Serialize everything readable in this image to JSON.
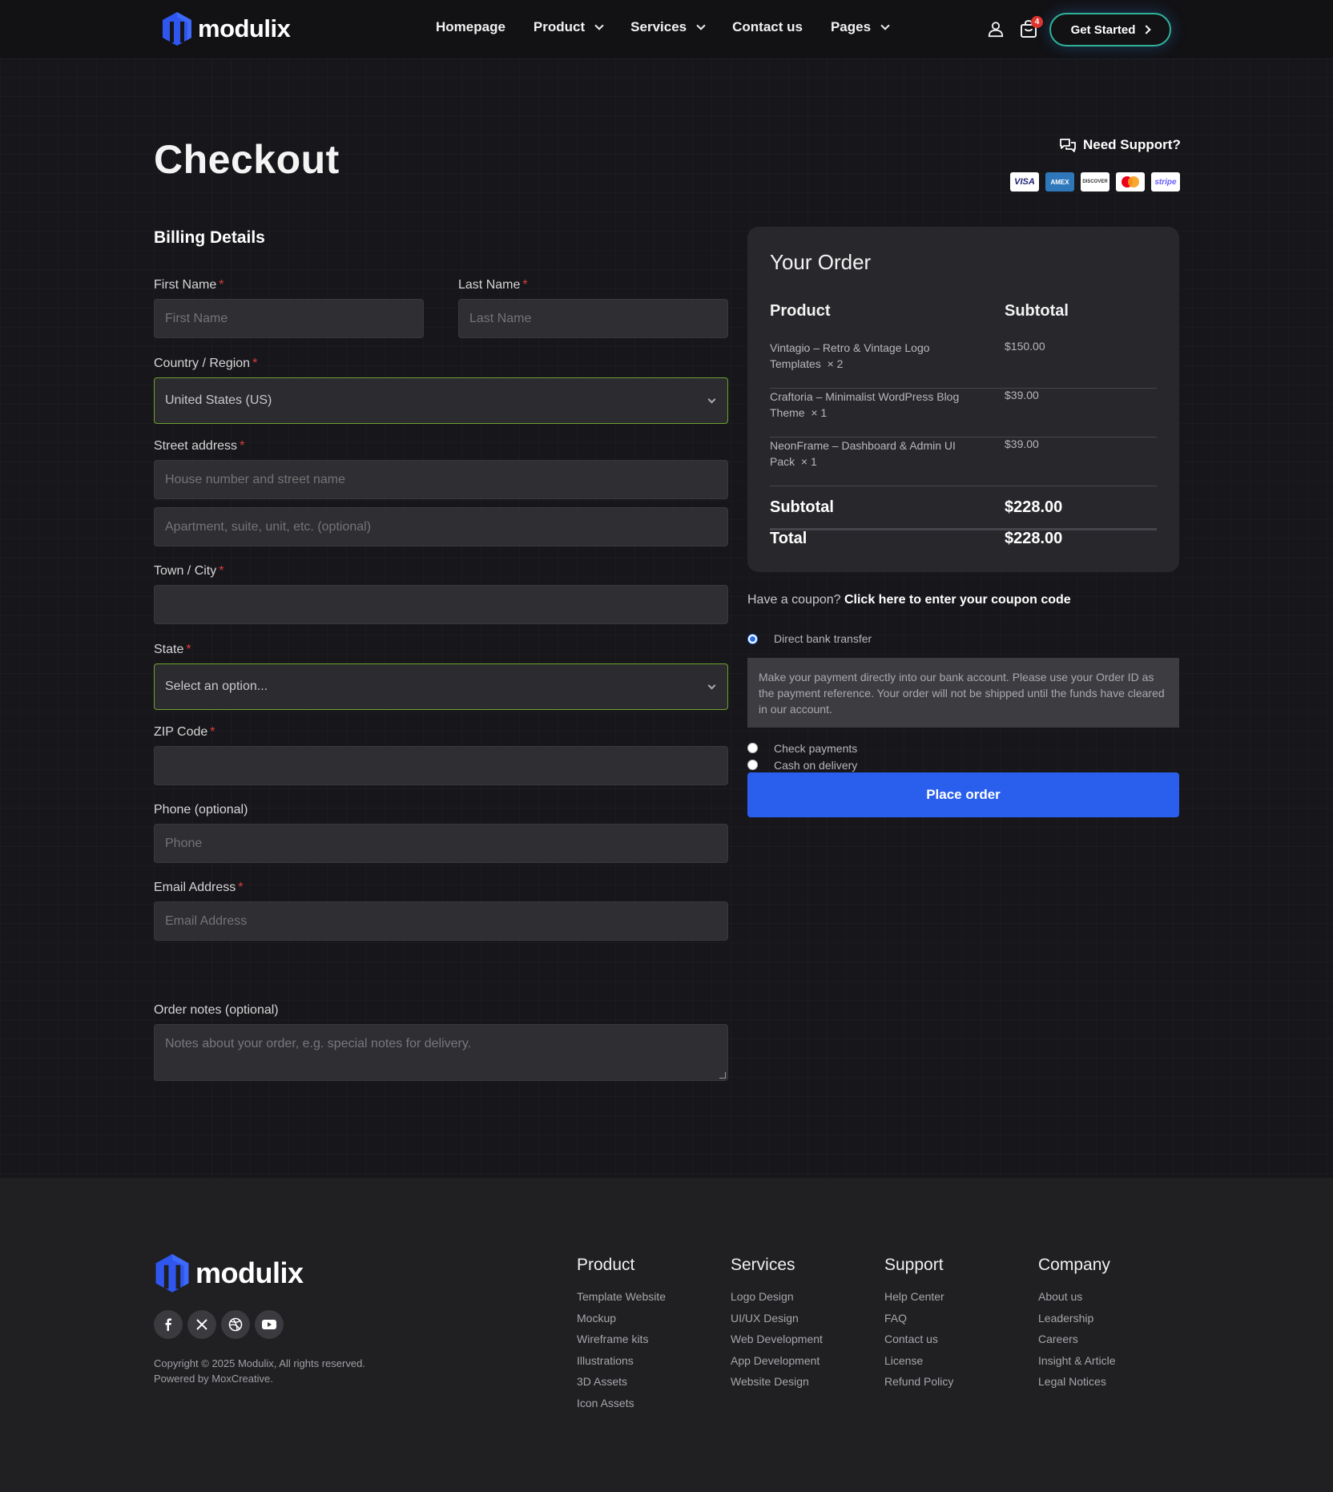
{
  "header": {
    "logo_text": "modulix",
    "nav": [
      {
        "label": "Homepage",
        "has_dropdown": false
      },
      {
        "label": "Product",
        "has_dropdown": true
      },
      {
        "label": "Services",
        "has_dropdown": true
      },
      {
        "label": "Contact us",
        "has_dropdown": false
      },
      {
        "label": "Pages",
        "has_dropdown": true
      }
    ],
    "cart_count": "4",
    "cta_label": "Get Started"
  },
  "page": {
    "title": "Checkout",
    "support_label": "Need Support?",
    "payment_cards": [
      "VISA",
      "AMEX",
      "DISCOVER",
      "Mastercard",
      "stripe"
    ]
  },
  "billing": {
    "title": "Billing Details",
    "first_name": {
      "label": "First Name",
      "placeholder": "First Name",
      "value": ""
    },
    "last_name": {
      "label": "Last Name",
      "placeholder": "Last Name",
      "value": ""
    },
    "country": {
      "label": "Country / Region",
      "value": "United States (US)"
    },
    "street": {
      "label": "Street address",
      "placeholder": "House number and street name",
      "placeholder2": "Apartment, suite, unit, etc. (optional)"
    },
    "city": {
      "label": "Town / City",
      "value": ""
    },
    "state": {
      "label": "State",
      "value": "Select an option..."
    },
    "zip": {
      "label": "ZIP Code",
      "value": ""
    },
    "phone": {
      "label": "Phone (optional)",
      "placeholder": "Phone"
    },
    "email": {
      "label": "Email Address",
      "placeholder": "Email Address"
    },
    "notes": {
      "label": "Order notes (optional)",
      "placeholder": "Notes about your order, e.g. special notes for delivery."
    }
  },
  "order": {
    "title": "Your Order",
    "col_product": "Product",
    "col_subtotal": "Subtotal",
    "items": [
      {
        "name": "Vintagio – Retro & Vintage Logo Templates",
        "qty": "× 2",
        "price": "$150.00"
      },
      {
        "name": "Craftoria – Minimalist WordPress Blog Theme",
        "qty": "× 1",
        "price": "$39.00"
      },
      {
        "name": "NeonFrame – Dashboard & Admin UI Pack",
        "qty": "× 1",
        "price": "$39.00"
      }
    ],
    "subtotal_label": "Subtotal",
    "subtotal_value": "$228.00",
    "total_label": "Total",
    "total_value": "$228.00"
  },
  "coupon": {
    "prompt": "Have a coupon?",
    "link": "Click here to enter your coupon code"
  },
  "payment": {
    "methods": [
      {
        "label": "Direct bank transfer",
        "selected": true
      },
      {
        "label": "Check payments",
        "selected": false
      },
      {
        "label": "Cash on delivery",
        "selected": false
      }
    ],
    "description": "Make your payment directly into our bank account. Please use your Order ID as the payment reference. Your order will not be shipped until the funds have cleared in our account.",
    "place_order_label": "Place order"
  },
  "footer": {
    "logo_text": "modulix",
    "socials": [
      "facebook-icon",
      "x-icon",
      "dribbble-icon",
      "youtube-icon"
    ],
    "copyright": "Copyright © 2025 Modulix, All rights reserved.",
    "powered_by": "Powered by MoxCreative.",
    "columns": [
      {
        "title": "Product",
        "links": [
          "Template Website",
          "Mockup",
          "Wireframe kits",
          "Illustrations",
          "3D Assets",
          "Icon Assets"
        ]
      },
      {
        "title": "Services",
        "links": [
          "Logo Design",
          "UI/UX Design",
          "Web Development",
          "App Development",
          "Website Design"
        ]
      },
      {
        "title": "Support",
        "links": [
          "Help Center",
          "FAQ",
          "Contact us",
          "License",
          "Refund Policy"
        ]
      },
      {
        "title": "Company",
        "links": [
          "About us",
          "Leadership",
          "Careers",
          "Insight & Article",
          "Legal Notices"
        ]
      }
    ]
  },
  "colors": {
    "accent_blue": "#2a5fee",
    "cta_border": "#2fb398",
    "select_border": "#6ea12e",
    "required": "#e03b3b",
    "badge": "#e0352c"
  }
}
